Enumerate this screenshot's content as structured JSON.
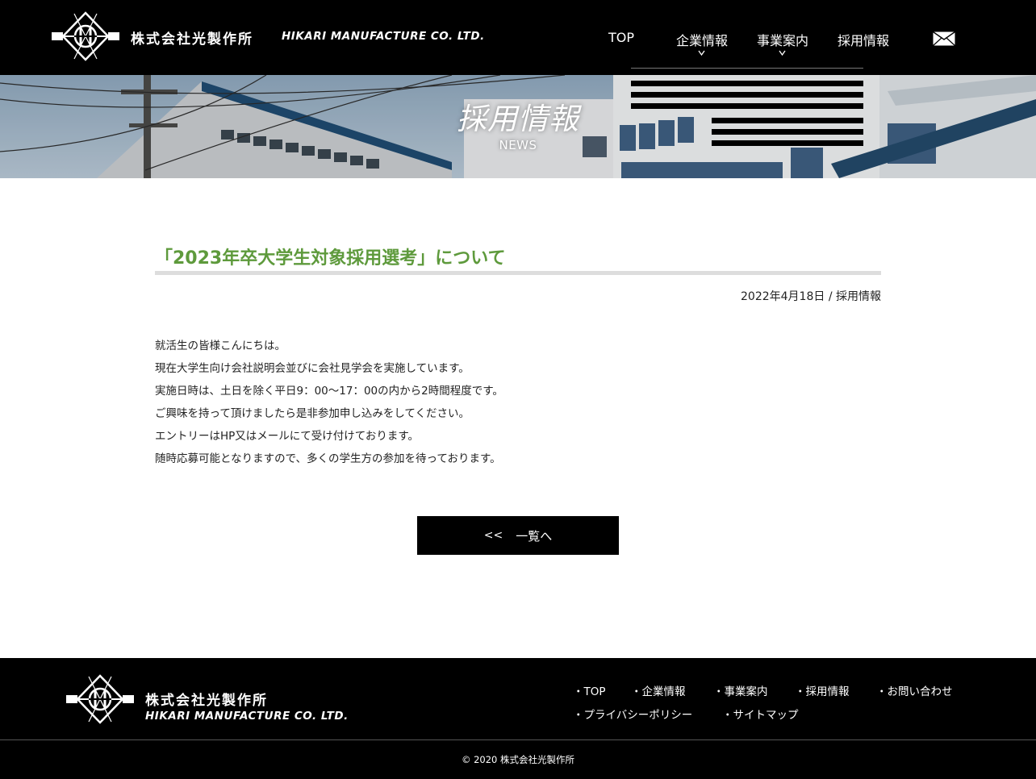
{
  "header": {
    "company_jp": "株式会社光製作所",
    "company_en": "HIKARI MANUFACTURE CO. LTD.",
    "nav": [
      {
        "label": "TOP"
      },
      {
        "label": "企業情報"
      },
      {
        "label": "事業案内"
      },
      {
        "label": "採用情報"
      }
    ],
    "mail_icon": "mail-icon"
  },
  "hero": {
    "title": "採用情報",
    "subtitle": "NEWS"
  },
  "article": {
    "title": "「2023年卒大学生対象採用選考」について",
    "date": "2022年4月18日",
    "separator": "/",
    "category": "採用情報",
    "paragraphs": [
      "就活生の皆様こんにちは。",
      "現在大学生向け会社説明会並びに会社見学会を実施しています。",
      "実施日時は、土日を除く平日9：00〜17：00の内から2時間程度です。",
      "ご興味を持って頂けましたら是非参加申し込みをしてください。",
      "エントリーはHP又はメールにて受け付けております。",
      "随時応募可能となりますので、多くの学生方の参加を待っております。"
    ],
    "back_arrows": "<<",
    "back_label": "一覧へ"
  },
  "footer": {
    "company_jp": "株式会社光製作所",
    "company_en": "HIKARI MANUFACTURE CO. LTD.",
    "links_row1": [
      "・TOP",
      "・企業情報",
      "・事業案内",
      "・採用情報",
      "・お問い合わせ"
    ],
    "links_row2": [
      "・プライバシーポリシー",
      "・サイトマップ"
    ],
    "copyright": "© 2020 株式会社光製作所"
  },
  "colors": {
    "header_bg": "#000000",
    "title_green": "#5e9a3c",
    "rule_gray": "#dddddd"
  }
}
